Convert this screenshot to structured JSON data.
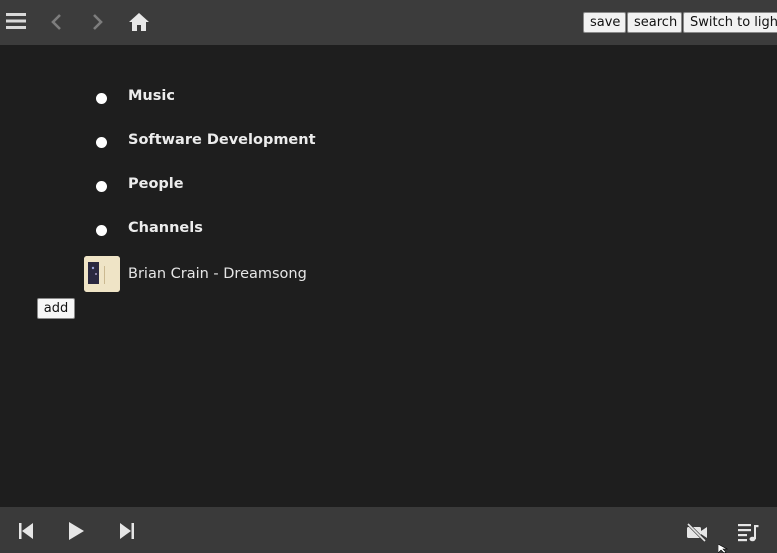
{
  "topbar": {
    "icons": [
      "menu-icon",
      "back-icon",
      "forward-icon",
      "home-icon"
    ],
    "save_label": "save",
    "search_label": "search",
    "theme_toggle_label": "Switch to light"
  },
  "list": {
    "categories": [
      {
        "label": "Music"
      },
      {
        "label": "Software Development"
      },
      {
        "label": "People"
      },
      {
        "label": "Channels"
      }
    ],
    "track": {
      "label": "Brian Crain - Dreamsong",
      "thumbnail_icon": "album-art"
    }
  },
  "add_label": "add",
  "player": {
    "icons": [
      "previous-track-icon",
      "play-icon",
      "next-track-icon",
      "video-off-icon",
      "queue-icon"
    ]
  },
  "colors": {
    "background": "#1e1e1e",
    "bar": "#3c3c3c",
    "text": "#e6e6e6",
    "button_bg": "#f2f2f2"
  }
}
